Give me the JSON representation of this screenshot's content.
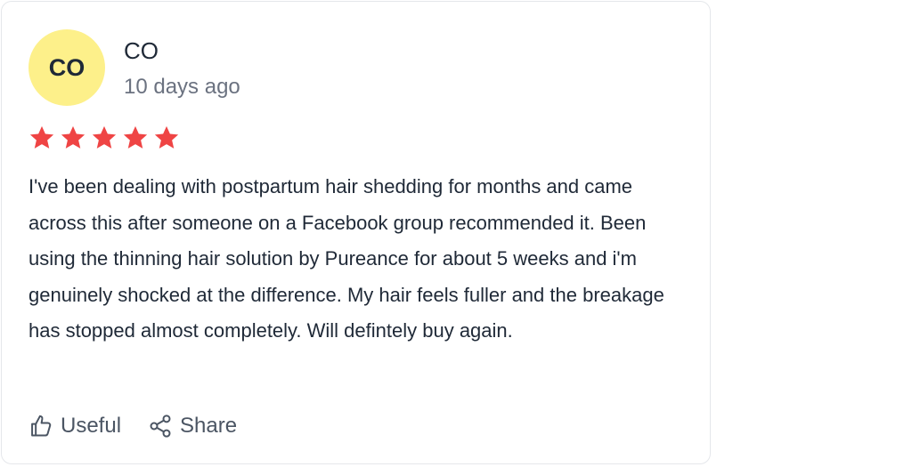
{
  "review": {
    "avatar_initials": "CO",
    "author": "CO",
    "date": "10 days ago",
    "rating": 5,
    "rating_max": 5,
    "body": "I've been dealing with postpartum hair shedding for months and came across this after someone on a Facebook group recommended it. Been using the thinning hair solution by Pureance for about 5 weeks and i'm genuinely shocked at the difference. My hair feels fuller and the breakage has stopped almost completely. Will defintely buy again.",
    "useful_label": "Useful",
    "share_label": "Share"
  },
  "icons": {
    "star": "star-icon",
    "useful": "thumbs-up-icon",
    "share": "share-icon"
  },
  "colors": {
    "avatar_bg": "#fdf08a",
    "star": "#ef4444",
    "text": "#1f2937",
    "muted": "#6b7280"
  }
}
